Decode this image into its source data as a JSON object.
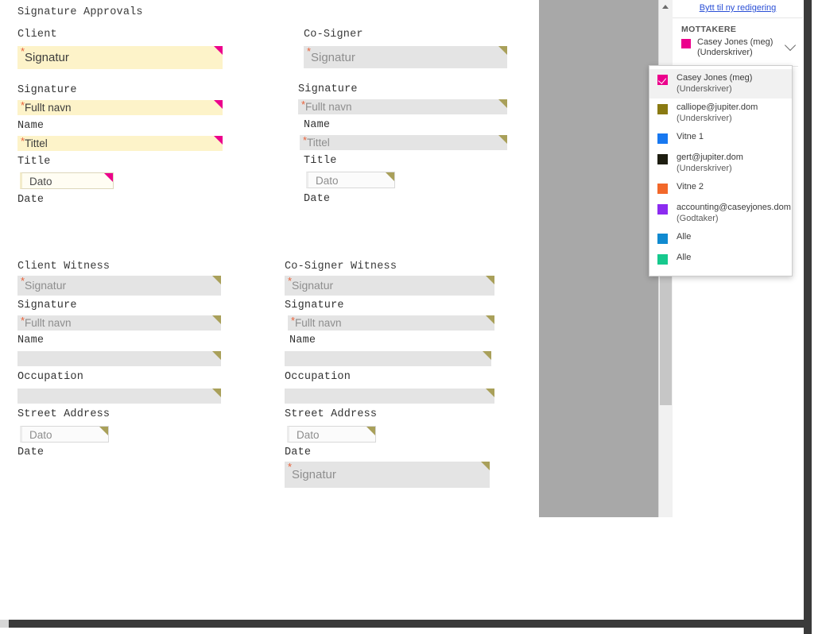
{
  "document": {
    "title": "Signature Approvals",
    "columns": [
      {
        "id": "client",
        "groups": [
          {
            "id": "client-main",
            "heading": "Client",
            "rows": [
              {
                "type": "sign",
                "style": "yellow",
                "placeholder": "Signatur",
                "required": true,
                "label": "Signature"
              },
              {
                "type": "text",
                "style": "yellow",
                "placeholder": "Fullt navn",
                "required": true,
                "label": "Name"
              },
              {
                "type": "text",
                "style": "yellow",
                "placeholder": "Tittel",
                "required": true,
                "label": "Title"
              },
              {
                "type": "date",
                "style": "yellow",
                "placeholder": "Dato",
                "required": false,
                "label": "Date"
              }
            ]
          },
          {
            "id": "client-witness",
            "heading": "Client Witness",
            "rows": [
              {
                "type": "sign",
                "style": "gray",
                "placeholder": "Signatur",
                "required": true,
                "label": "Signature"
              },
              {
                "type": "text",
                "style": "gray",
                "placeholder": "Fullt navn",
                "required": true,
                "label": "Name"
              },
              {
                "type": "text",
                "style": "gray",
                "placeholder": "",
                "required": false,
                "label": "Occupation"
              },
              {
                "type": "text",
                "style": "gray",
                "placeholder": "",
                "required": false,
                "label": "Street Address"
              },
              {
                "type": "date",
                "style": "gray",
                "placeholder": "Dato",
                "required": false,
                "label": "Date"
              }
            ]
          }
        ]
      },
      {
        "id": "cosigner",
        "groups": [
          {
            "id": "cosigner-main",
            "heading": "Co-Signer",
            "rows": [
              {
                "type": "sign",
                "style": "gray",
                "placeholder": "Signatur",
                "required": true,
                "label": "Signature"
              },
              {
                "type": "text",
                "style": "gray",
                "placeholder": "Fullt navn",
                "required": true,
                "label": "Name"
              },
              {
                "type": "text",
                "style": "gray",
                "placeholder": "Tittel",
                "required": true,
                "label": "Title"
              },
              {
                "type": "date",
                "style": "gray",
                "placeholder": "Dato",
                "required": false,
                "label": "Date"
              }
            ]
          },
          {
            "id": "cosigner-witness",
            "heading": "Co-Signer Witness",
            "rows": [
              {
                "type": "sign",
                "style": "gray",
                "placeholder": "Signatur",
                "required": true,
                "label": "Signature"
              },
              {
                "type": "text",
                "style": "gray",
                "placeholder": "Fullt navn",
                "required": true,
                "label": "Name"
              },
              {
                "type": "text",
                "style": "gray",
                "placeholder": "",
                "required": false,
                "label": "Occupation"
              },
              {
                "type": "text",
                "style": "gray",
                "placeholder": "",
                "required": false,
                "label": "Street Address"
              },
              {
                "type": "date",
                "style": "gray",
                "placeholder": "Dato",
                "required": false,
                "label": "Date"
              }
            ]
          },
          {
            "id": "cosigner-extra",
            "heading": "",
            "rows": [
              {
                "type": "sign",
                "style": "gray",
                "placeholder": "Signatur",
                "required": true,
                "label": ""
              }
            ]
          }
        ]
      }
    ],
    "required_marker": "*"
  },
  "sidebar": {
    "switch_link": "Bytt til ny redigering",
    "recipients_heading": "MOTTAKERE",
    "current_recipient": {
      "name": "Casey Jones (meg)",
      "role": "(Underskriver)",
      "color": "#ec008c"
    },
    "chevron_icon": "chevron-down-icon"
  },
  "dropdown": {
    "items": [
      {
        "name": "Casey Jones (meg)",
        "role": "(Underskriver)",
        "color": "#ec008c",
        "selected": true
      },
      {
        "name": "calliope@jupiter.dom",
        "role": "(Underskriver)",
        "color": "#8a7a12",
        "selected": false
      },
      {
        "name": "Vitne 1",
        "role": "",
        "color": "#1878f0",
        "selected": false
      },
      {
        "name": "gert@jupiter.dom",
        "role": "(Underskriver)",
        "color": "#1d1d10",
        "selected": false
      },
      {
        "name": "Vitne 2",
        "role": "",
        "color": "#f2682a",
        "selected": false
      },
      {
        "name": "accounting@caseyjones.dom",
        "role": "(Godtaker)",
        "color": "#8c2bf0",
        "selected": false
      },
      {
        "name": "Alle",
        "role": "",
        "color": "#108ad0",
        "selected": false
      },
      {
        "name": "Alle",
        "role": "",
        "color": "#16c98d",
        "selected": false
      }
    ]
  },
  "scrollbar": {
    "up_arrow_icon": "scroll-up-arrow-icon"
  },
  "colors": {
    "active_field_bg": "#fdf3c9",
    "active_marker": "#ec008c",
    "inactive_field_bg": "#e4e4e4",
    "inactive_marker": "#a9a05a",
    "link": "#2a4fd6",
    "panel_gray": "#a8a8a8"
  }
}
